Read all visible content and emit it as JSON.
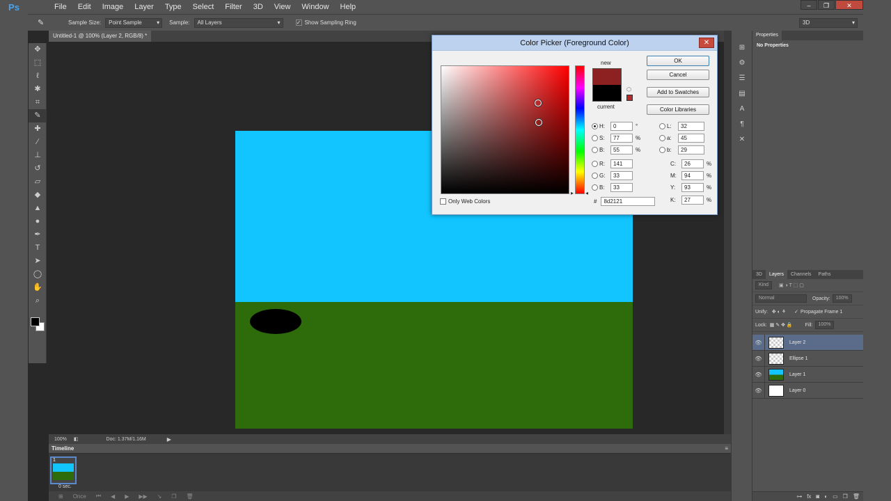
{
  "app": {
    "logo": "Ps"
  },
  "menu": [
    "File",
    "Edit",
    "Image",
    "Layer",
    "Type",
    "Select",
    "Filter",
    "3D",
    "View",
    "Window",
    "Help"
  ],
  "window_controls": {
    "minimize": "‒",
    "restore": "❐",
    "close": "✕"
  },
  "options_bar": {
    "tool_icon": "eyedropper-icon",
    "sample_size_label": "Sample Size:",
    "sample_size_value": "Point Sample",
    "sample_label": "Sample:",
    "sample_value": "All Layers",
    "show_sampling_ring_label": "Show Sampling Ring",
    "show_sampling_ring_checked": true,
    "workspace_value": "3D"
  },
  "document": {
    "tab_title": "Untitled-1 @ 100% (Layer 2, RGB/8) *",
    "sky_color": "#12c5ff",
    "ground_color": "#2d6b0b",
    "ellipse_color": "#000000"
  },
  "tools": [
    "move-tool",
    "marquee-tool",
    "lasso-tool",
    "quick-select-tool",
    "crop-tool",
    "eyedropper-tool",
    "healing-brush-tool",
    "brush-tool",
    "clone-stamp-tool",
    "history-brush-tool",
    "eraser-tool",
    "paint-bucket-tool",
    "blur-tool",
    "dodge-tool",
    "pen-tool",
    "type-tool",
    "path-select-tool",
    "ellipse-tool",
    "hand-tool",
    "zoom-tool"
  ],
  "colors": {
    "foreground": "#000000",
    "background": "#ffffff"
  },
  "status": {
    "zoom": "100%",
    "doc_info": "Doc: 1.37M/1.16M"
  },
  "timeline": {
    "title": "Timeline",
    "frame_number": "1",
    "frame_time": "0 sec.",
    "loop": "Once"
  },
  "properties": {
    "tab": "Properties",
    "content": "No Properties"
  },
  "layers_panel": {
    "tabs": [
      "3D",
      "Layers",
      "Channels",
      "Paths"
    ],
    "active_tab": "Layers",
    "filter_kind": "Kind",
    "blend_mode": "Normal",
    "opacity_label": "Opacity:",
    "opacity_value": "100%",
    "unify_label": "Unify:",
    "propagate_label": "Propagate Frame 1",
    "lock_label": "Lock:",
    "fill_label": "Fill:",
    "fill_value": "100%",
    "layers": [
      {
        "name": "Layer 2",
        "thumb": "transparent",
        "selected": true
      },
      {
        "name": "Ellipse 1",
        "thumb": "transparent",
        "selected": false
      },
      {
        "name": "Layer 1",
        "thumb": "scene",
        "selected": false
      },
      {
        "name": "Layer 0",
        "thumb": "white",
        "selected": false
      }
    ]
  },
  "color_picker": {
    "title": "Color Picker (Foreground Color)",
    "close": "✕",
    "new_label": "new",
    "current_label": "current",
    "new_color": "#8d2121",
    "current_color": "#000000",
    "buttons": {
      "ok": "OK",
      "cancel": "Cancel",
      "add_to_swatches": "Add to Swatches",
      "color_libraries": "Color Libraries"
    },
    "hsb": {
      "h_label": "H:",
      "h": "0",
      "h_unit": "°",
      "s_label": "S:",
      "s": "77",
      "s_unit": "%",
      "b_label": "B:",
      "b": "55",
      "b_unit": "%"
    },
    "rgb": {
      "r_label": "R:",
      "r": "141",
      "g_label": "G:",
      "g": "33",
      "b_label": "B:",
      "b": "33"
    },
    "lab": {
      "l_label": "L:",
      "l": "32",
      "a_label": "a:",
      "a": "45",
      "b_label": "b:",
      "b": "29"
    },
    "cmyk": {
      "c_label": "C:",
      "c": "26",
      "c_unit": "%",
      "m_label": "M:",
      "m": "94",
      "m_unit": "%",
      "y_label": "Y:",
      "y": "93",
      "y_unit": "%",
      "k_label": "K:",
      "k": "27",
      "k_unit": "%"
    },
    "hex_label": "#",
    "hex": "8d2121",
    "only_web_colors_label": "Only Web Colors"
  }
}
